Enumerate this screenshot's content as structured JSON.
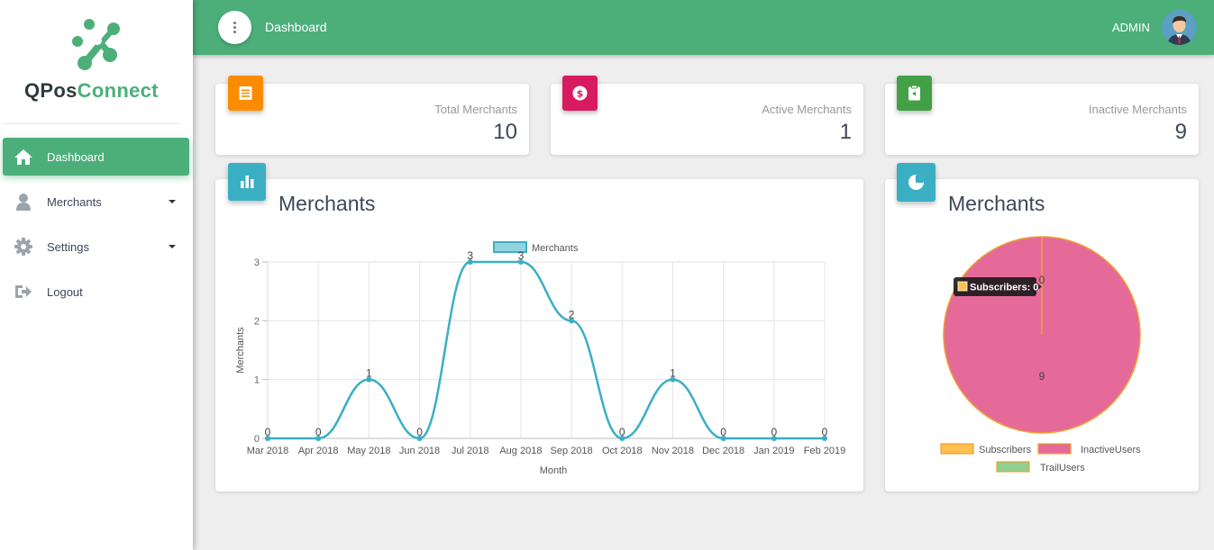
{
  "app": {
    "logo_part1": "QPos",
    "logo_part2": "Connect"
  },
  "sidebar": {
    "items": [
      {
        "label": "Dashboard",
        "icon": "home-icon",
        "active": true
      },
      {
        "label": "Merchants",
        "icon": "user-icon"
      },
      {
        "label": "Settings",
        "icon": "gear-icon"
      },
      {
        "label": "Logout",
        "icon": "logout-icon"
      }
    ]
  },
  "topbar": {
    "title": "Dashboard",
    "user": "ADMIN"
  },
  "stats": [
    {
      "label": "Total Merchants",
      "value": "10",
      "color": "#fb8c00"
    },
    {
      "label": "Active Merchants",
      "value": "1",
      "color": "#d81b60"
    },
    {
      "label": "Inactive Merchants",
      "value": "9",
      "color": "#43a047"
    }
  ],
  "chart_data": [
    {
      "type": "line",
      "title": "Merchants",
      "x": [
        "Mar 2018",
        "Apr 2018",
        "May 2018",
        "Jun 2018",
        "Jul 2018",
        "Aug 2018",
        "Sep 2018",
        "Oct 2018",
        "Nov 2018",
        "Dec 2018",
        "Jan 2019",
        "Feb 2019"
      ],
      "series": [
        {
          "name": "Merchants",
          "values": [
            0,
            0,
            1,
            0,
            3,
            3,
            2,
            0,
            1,
            0,
            0,
            0
          ]
        }
      ],
      "xlabel": "Month",
      "ylabel": "Merchants",
      "ylim": [
        0,
        3
      ],
      "yticks": [
        "0",
        "1",
        "2",
        "3"
      ],
      "grid": true,
      "legend": "top",
      "color": "#3aafc4"
    },
    {
      "type": "pie",
      "title": "Merchants",
      "labels": [
        "Subscribers",
        "InactiveUsers",
        "TrailUsers"
      ],
      "values": [
        0,
        9,
        0
      ],
      "colors": [
        "#ffc050",
        "#e56a99",
        "#8fcf8f"
      ],
      "tooltip": "Subscribers: 0",
      "legend": "bottom"
    }
  ]
}
